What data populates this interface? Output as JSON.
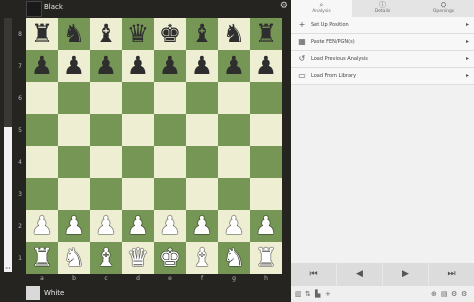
{
  "top_player": {
    "name": "Black"
  },
  "bottom_player": {
    "name": "White"
  },
  "eval": {
    "white_fraction": 0.57,
    "score": "0.1"
  },
  "board": {
    "ranks": [
      [
        "♜",
        "♞",
        "♝",
        "♛",
        "♚",
        "♝",
        "♞",
        "♜"
      ],
      [
        "♟",
        "♟",
        "♟",
        "♟",
        "♟",
        "♟",
        "♟",
        "♟"
      ],
      [
        "",
        "",
        "",
        "",
        "",
        "",
        "",
        ""
      ],
      [
        "",
        "",
        "",
        "",
        "",
        "",
        "",
        ""
      ],
      [
        "",
        "",
        "",
        "",
        "",
        "",
        "",
        ""
      ],
      [
        "",
        "",
        "",
        "",
        "",
        "",
        "",
        ""
      ],
      [
        "♟",
        "♟",
        "♟",
        "♟",
        "♟",
        "♟",
        "♟",
        "♟"
      ],
      [
        "♜",
        "♞",
        "♝",
        "♛",
        "♚",
        "♝",
        "♞",
        "♜"
      ]
    ],
    "colors": [
      "b",
      "b",
      "",
      "",
      "",
      "",
      "w",
      "w"
    ],
    "rank_labels": [
      "8",
      "7",
      "6",
      "5",
      "4",
      "3",
      "2",
      "1"
    ],
    "file_labels": [
      "a",
      "b",
      "c",
      "d",
      "e",
      "f",
      "g",
      "h"
    ],
    "light_color": "#eeeed2",
    "dark_color": "#769656"
  },
  "tabs": [
    {
      "label": "Analysis",
      "icon": "magnifier-icon",
      "glyph": "⌕"
    },
    {
      "label": "Details",
      "icon": "info-icon",
      "glyph": "ⓘ"
    },
    {
      "label": "Openings",
      "icon": "book-icon",
      "glyph": "⛭"
    }
  ],
  "menu": [
    {
      "label": "Set Up Position",
      "icon": "plus-icon",
      "glyph": "+"
    },
    {
      "label": "Paste FEN/PGN(s)",
      "icon": "board-icon",
      "glyph": "▦"
    },
    {
      "label": "Load Previous Analysis",
      "icon": "history-icon",
      "glyph": "↺"
    },
    {
      "label": "Load From Library",
      "icon": "folder-icon",
      "glyph": "▭"
    }
  ],
  "nav": [
    {
      "name": "first-move-button",
      "glyph": "⏮"
    },
    {
      "name": "prev-move-button",
      "glyph": "◀"
    },
    {
      "name": "next-move-button",
      "glyph": "▶"
    },
    {
      "name": "last-move-button",
      "glyph": "⏭"
    }
  ],
  "tools_left": [
    {
      "name": "chart-icon",
      "glyph": "▥"
    },
    {
      "name": "flip-icon",
      "glyph": "⇅"
    },
    {
      "name": "share-icon",
      "glyph": "▙"
    },
    {
      "name": "add-icon",
      "glyph": "+"
    }
  ],
  "tools_right": [
    {
      "name": "zoom-icon",
      "glyph": "⊕"
    },
    {
      "name": "library-icon",
      "glyph": "▤"
    },
    {
      "name": "engine-icon",
      "glyph": "⚙"
    },
    {
      "name": "settings-icon",
      "glyph": "⚙"
    }
  ]
}
